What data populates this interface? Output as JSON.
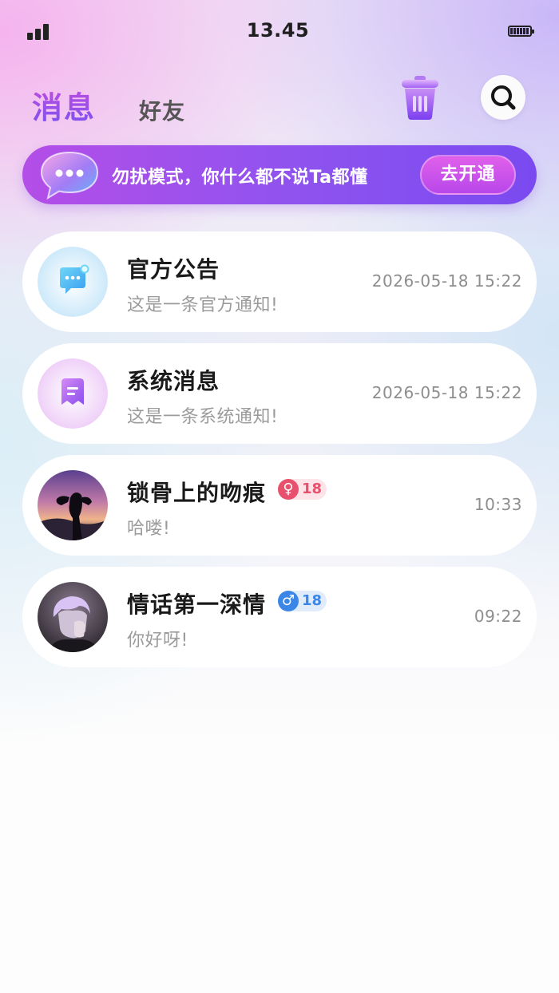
{
  "status_bar": {
    "time": "13.45"
  },
  "header": {
    "tabs": [
      {
        "label": "消息",
        "active": true
      },
      {
        "label": "好友",
        "active": false
      }
    ],
    "icons": {
      "trash": "trash-icon",
      "search": "search-icon"
    }
  },
  "banner": {
    "icon": "chat-bubble-icon",
    "text": "勿扰模式，你什么都不说Ta都懂",
    "button_label": "去开通"
  },
  "messages": [
    {
      "name": "官方公告",
      "preview": "这是一条官方通知!",
      "timestamp": "2026-05-18   15:22",
      "icon": "announcement-icon"
    },
    {
      "name": "系统消息",
      "preview": "这是一条系统通知!",
      "timestamp": "2026-05-18   15:22",
      "icon": "system-message-icon"
    },
    {
      "name": "锁骨上的吻痕",
      "preview": "哈喽!",
      "timestamp": "10:33",
      "gender": "female",
      "gender_symbol": "♀",
      "age": "18"
    },
    {
      "name": "情话第一深情",
      "preview": "你好呀!",
      "timestamp": "09:22",
      "gender": "male",
      "gender_symbol": "♂",
      "age": "18"
    }
  ],
  "colors": {
    "accent": "#9a4de6",
    "banner_start": "#b44ee8",
    "banner_end": "#7a4af0",
    "female": "#e8516e",
    "male": "#3b86e6"
  }
}
